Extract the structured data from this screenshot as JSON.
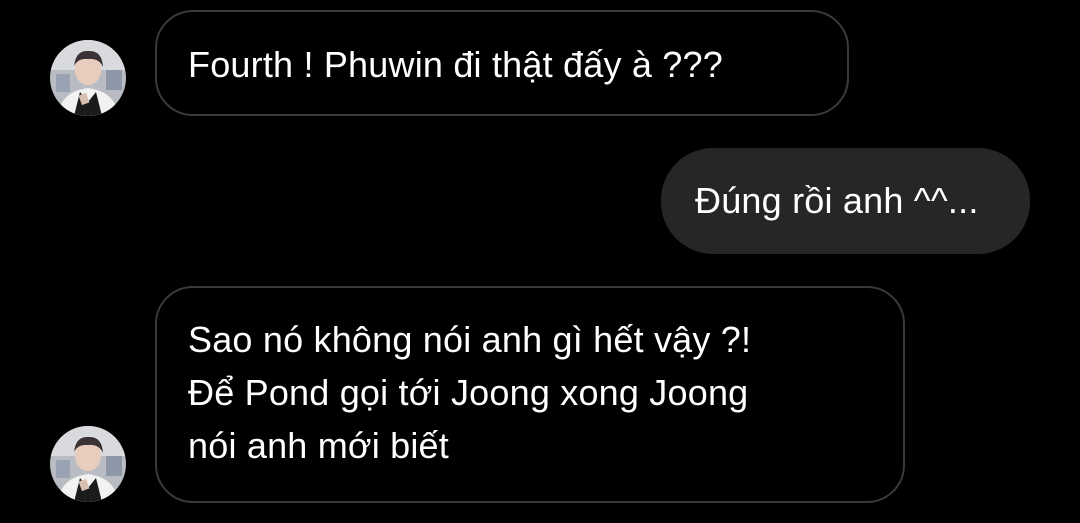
{
  "messages": [
    {
      "direction": "incoming",
      "lines": [
        "Fourth ! Phuwin đi thật đấy à ???"
      ],
      "show_avatar": true
    },
    {
      "direction": "outgoing",
      "lines": [
        "Đúng rồi anh ^^..."
      ],
      "show_avatar": false
    },
    {
      "direction": "incoming",
      "lines": [
        "Sao nó không nói anh gì hết vậy ?!",
        "Để Pond gọi tới Joong xong Joong",
        "nói anh mới biết"
      ],
      "show_avatar": true
    }
  ],
  "colors": {
    "background": "#000000",
    "incoming_border": "#3a3a3a",
    "outgoing_bubble": "#262626",
    "text": "#ffffff"
  }
}
